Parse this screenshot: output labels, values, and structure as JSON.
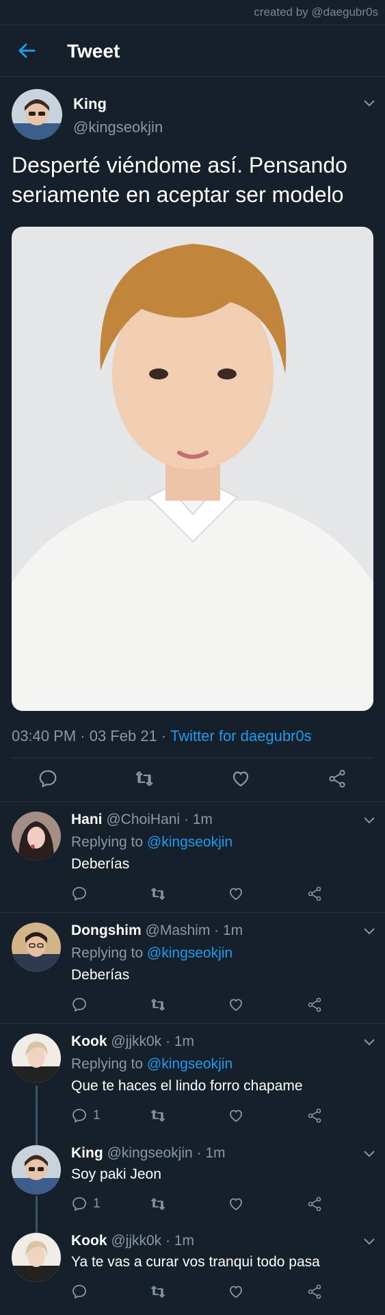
{
  "credit": "created by @daegubr0s",
  "header": {
    "title": "Tweet"
  },
  "colors": {
    "background": "#15202b",
    "accent": "#1d9bf0",
    "muted": "#8899a6",
    "divider": "#283440"
  },
  "tweet": {
    "name": "King",
    "handle": "@kingseokjin",
    "text": "Desperté viéndome así. Pensando seriamente en aceptar ser modelo",
    "time": "03:40 PM · 03 Feb 21 · ",
    "source": "Twitter for daegubr0s",
    "actions": [
      "reply-icon",
      "retweet-icon",
      "like-icon",
      "share-icon"
    ]
  },
  "replies": [
    {
      "name": "Hani",
      "meta": " @ChoiHani · 1m",
      "replying": "Replying to ",
      "replying_to": "@kingseokjin",
      "text": "Deberías",
      "reply_count": ""
    },
    {
      "name": "Dongshim",
      "meta": " @Mashim · 1m",
      "replying": "Replying to ",
      "replying_to": "@kingseokjin",
      "text": "Deberías",
      "reply_count": ""
    },
    {
      "name": "Kook",
      "meta": " @jjkk0k · 1m",
      "replying": "Replying to ",
      "replying_to": "@kingseokjin",
      "text": "Que te haces el lindo forro chapame",
      "reply_count": "1"
    },
    {
      "name": "King",
      "meta": " @kingseokjin · 1m",
      "text": "Soy paki Jeon",
      "reply_count": "1"
    },
    {
      "name": "Kook",
      "meta": " @jjkk0k · 1m",
      "text": "Ya te vas a curar vos tranqui todo pasa",
      "reply_count": ""
    }
  ]
}
